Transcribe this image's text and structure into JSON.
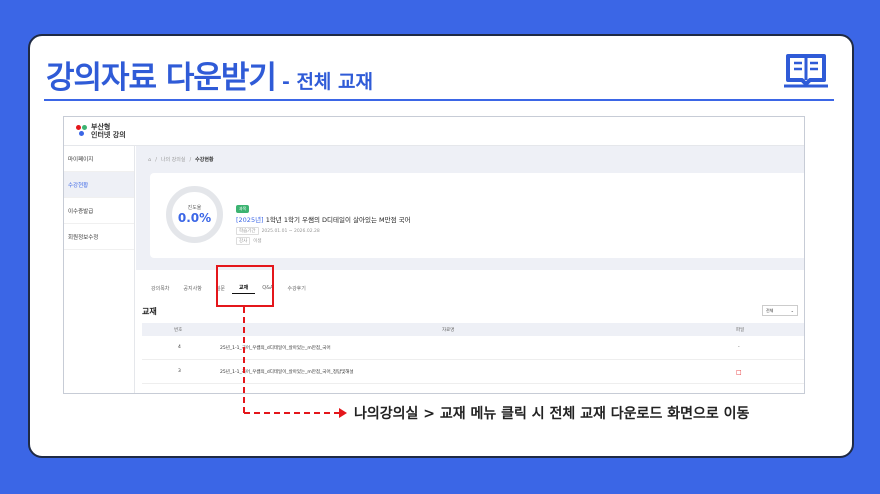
{
  "slide": {
    "title_main": "강의자료 다운받기",
    "title_sub": "- 전체 교재",
    "caption": "나의강의실 > 교재 메뉴 클릭 시 전체 교재 다운로드 화면으로 이동"
  },
  "site": {
    "logo_line1": "부산형",
    "logo_line2": "인터넷 강의"
  },
  "sidebar": {
    "items": [
      {
        "label": "마이페이지"
      },
      {
        "label": "수강현황"
      },
      {
        "label": "이수증발급"
      },
      {
        "label": "회원정보수정"
      }
    ]
  },
  "breadcrumb": {
    "item1": "나의 강의실",
    "sep": "/",
    "item2": "수강현황"
  },
  "course": {
    "progress_label": "진도율",
    "progress_value": "0.0%",
    "badge": "과목",
    "year_tag": "[2025년]",
    "title": "1학년 1학기 우쌤의 D디테일이 살아있는 M만점 국어",
    "period_label": "학습기간",
    "period_value": "2025.01.01 ~ 2026.02.28",
    "teacher_label": "강사",
    "teacher_value": "이샘"
  },
  "tabs": [
    {
      "label": "강의목차"
    },
    {
      "label": "공지사항"
    },
    {
      "label": "질문"
    },
    {
      "label": "교재"
    },
    {
      "label": "Q&A"
    },
    {
      "label": "수강후기"
    }
  ],
  "materials": {
    "section_title": "교재",
    "filter_value": "전체",
    "columns": {
      "no": "번호",
      "name": "자료명",
      "file": "파일"
    },
    "rows": [
      {
        "no": "4",
        "name": "25년_1-1_국어_우쌤의_d디테일이_살아있는_m만점_국어",
        "file": "-"
      },
      {
        "no": "3",
        "name": "25년_1-1_국어_우쌤의_d디테일이_살아있는_m만점_국어_정답및해설",
        "file": "pdf"
      }
    ]
  },
  "colors": {
    "background": "#3b66e6",
    "accent": "#2f5bd7",
    "highlight": "#e4161b"
  }
}
